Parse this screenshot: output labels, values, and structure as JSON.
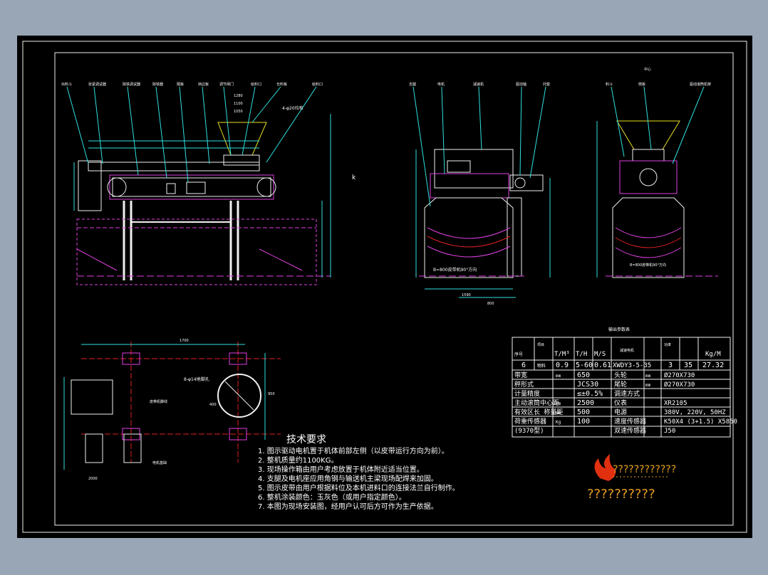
{
  "view_side": {
    "callouts": [
      "出料斗",
      "张紧调试器",
      "除铁调试器",
      "除铁器",
      "隔板",
      "挡边板",
      "调节闸门",
      "给料口",
      "仓料板",
      "给料口"
    ],
    "dim_h": [
      "1280",
      "1100",
      "1050"
    ],
    "dim_dia": "4-φ20均布",
    "letter": "k"
  },
  "view_front": {
    "callouts": [
      "支腿",
      "电机",
      "减速机",
      "驱动轴",
      "托辊"
    ],
    "belt_note": "B=800皮带机90°方向",
    "dims": [
      "1590",
      "800"
    ]
  },
  "view_end": {
    "callouts": [
      "料斗",
      "侧板",
      "驱动滚筒机架"
    ],
    "top_label": "中心",
    "belt_note": "B=800皮带机90°方向"
  },
  "foundation": {
    "hole_note": "8-φ14地脚孔",
    "callouts": [
      "皮带机脚线",
      "电机基础"
    ],
    "dims": [
      "1700",
      "950",
      "400",
      "2000"
    ]
  },
  "tech": {
    "title": "技术要求",
    "items": [
      "1. 图示驱动电机置于机体前部左侧（以皮带运行方向为前）。",
      "2. 整机质量约1100KG。",
      "3. 现场操作箱由用户考虑放置于机体附近适当位置。",
      "4. 支腿及电机座应用角钢与输送机主梁现场配焊来加固。",
      "5. 图示皮带由用户根据料位及本机进料口的连接法兰自行制作。",
      "6. 整机涂装颜色：玉灰色（或用户指定颜色）。",
      "7. 本图为现场安装图，经用户认可后方可作为生产依据。"
    ]
  },
  "params": {
    "caption": "输出参数表",
    "header": [
      "序号",
      "项目",
      "T/M³",
      "T/H",
      "M/S",
      "减速电机",
      "功率",
      "",
      "Kg/M"
    ],
    "row1": [
      "6",
      "物料",
      "0.9",
      "5-60",
      "0.61",
      "XWDY3-5-35",
      "3",
      "35",
      "27.32"
    ],
    "rows": [
      [
        "带宽",
        "mm",
        "650",
        "头轮",
        "mm",
        "Ø270X730"
      ],
      [
        "秤形式",
        "",
        "JCS30",
        "尾轮",
        "mm",
        "Ø270X730"
      ],
      [
        "计量精度",
        "",
        "≤±0.5%",
        "调速方式",
        "",
        ""
      ],
      [
        "主动滚筒中心距",
        "mm",
        "2500",
        "仪表",
        "",
        "XR2105"
      ],
      [
        "有效区长 称量距",
        "mm",
        "500",
        "电源",
        "",
        "380V, 220V, 50HZ"
      ],
      [
        "荷重传感器",
        "Kg",
        "100",
        "速度传感器",
        "",
        "K50X4 (3+1.5) X5850"
      ],
      [
        "(9370型)",
        "",
        "",
        "双速传感器",
        "",
        "J50"
      ]
    ]
  },
  "logo": {
    "line1": "????????????",
    "line2": "??????????"
  },
  "colors": {
    "frame": "#000000",
    "bg": "#98a6b6",
    "magenta": "#e040e0",
    "red": "#e02020",
    "cyan": "#30e0e0",
    "white": "#f0f0f0",
    "yellow": "#e8e020"
  }
}
